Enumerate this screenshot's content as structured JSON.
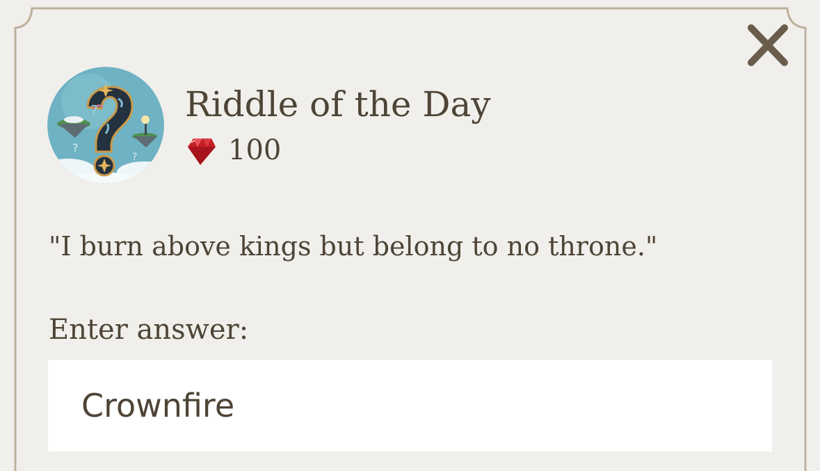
{
  "dialog": {
    "title": "Riddle of the Day",
    "reward": {
      "icon": "ruby-gem-icon",
      "value": "100"
    },
    "riddle": "\"I burn above kings but belong to no throne.\"",
    "answer_label": "Enter answer:",
    "answer_value": "Crownfire",
    "close_icon": "close-icon"
  },
  "colors": {
    "background": "#f1efeb",
    "frame": "#bdb09c",
    "text": "#4e4436",
    "gem": "#c41f25",
    "input_bg": "#ffffff"
  }
}
